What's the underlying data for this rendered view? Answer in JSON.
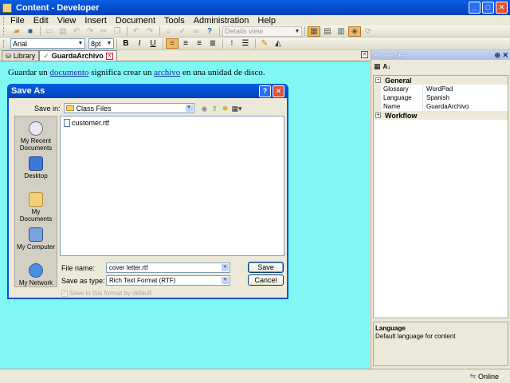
{
  "window": {
    "title": "Content - Developer",
    "buttons": [
      "_",
      "□",
      "✕"
    ]
  },
  "menubar": [
    "File",
    "Edit",
    "View",
    "Insert",
    "Document",
    "Tools",
    "Administration",
    "Help"
  ],
  "toolbar": {
    "view_combo": "Details view"
  },
  "format_toolbar": {
    "font": "Arial",
    "size": "8pt",
    "bold": "B",
    "italic": "I",
    "underline": "U"
  },
  "tabs": [
    {
      "label": "Library",
      "active": false
    },
    {
      "label": "GuardaArchivo",
      "active": true
    }
  ],
  "editor": {
    "text_before": "Guardar un ",
    "link1": "documento",
    "text_mid": " significa crear un ",
    "link2": "archivo",
    "text_after": " en una unidad de disco.",
    "background": "#7ff7f5"
  },
  "properties": {
    "title": "Properties",
    "categories": [
      {
        "name": "General",
        "expanded": true,
        "rows": [
          {
            "key": "Glossary",
            "value": "WordPad"
          },
          {
            "key": "Language",
            "value": "Spanish"
          },
          {
            "key": "Name",
            "value": "GuardaArchivo"
          }
        ]
      },
      {
        "name": "Workflow",
        "expanded": false,
        "rows": []
      }
    ],
    "help_title": "Language",
    "help_text": "Default language for content"
  },
  "statusbar": {
    "status": "Online"
  },
  "dialog": {
    "title": "Save As",
    "save_in_label": "Save in:",
    "save_in_value": "Class Files",
    "places": [
      "My Recent Documents",
      "Desktop",
      "My Documents",
      "My Computer",
      "My Network"
    ],
    "files": [
      "customer.rtf"
    ],
    "file_name_label": "File name:",
    "file_name_value": "cover letter.rtf",
    "save_type_label": "Save as type:",
    "save_type_value": "Rich Text Format (RTF)",
    "save_button": "Save",
    "cancel_button": "Cancel",
    "checkbox_label": "Save in this format by default"
  }
}
